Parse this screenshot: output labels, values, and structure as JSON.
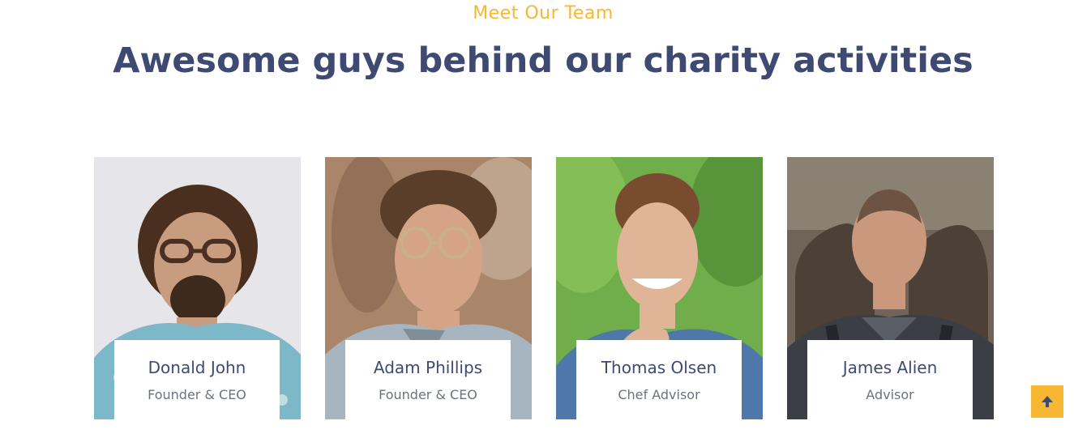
{
  "section": {
    "eyebrow": "Meet Our Team",
    "title": "Awesome guys behind our charity activities"
  },
  "team": [
    {
      "name": "Donald John",
      "role": "Founder & CEO",
      "photo": {
        "bg": "#e6e6ea",
        "skin": "#c89d7f",
        "hair": "#4a2f1e",
        "shirt": "#7cb8c7"
      }
    },
    {
      "name": "Adam Phillips",
      "role": "Founder & CEO",
      "photo": {
        "bg": "#a98569",
        "skin": "#d5a487",
        "hair": "#5b3e29",
        "shirt": "#a7b5c1"
      }
    },
    {
      "name": "Thomas Olsen",
      "role": "Chef Advisor",
      "photo": {
        "bg": "#6fae4a",
        "skin": "#e0b497",
        "hair": "#7a4c2f",
        "shirt": "#4d78a9"
      }
    },
    {
      "name": "James Alien",
      "role": "Advisor",
      "photo": {
        "bg": "#6f6457",
        "skin": "#c9987d",
        "hair": "#6d5442",
        "shirt": "#3b3e44"
      }
    }
  ],
  "icons": {
    "scroll_top": "arrow-up-icon"
  },
  "colors": {
    "accent": "#f7b733",
    "heading": "#3f4a72",
    "muted_text": "#6b7280"
  }
}
